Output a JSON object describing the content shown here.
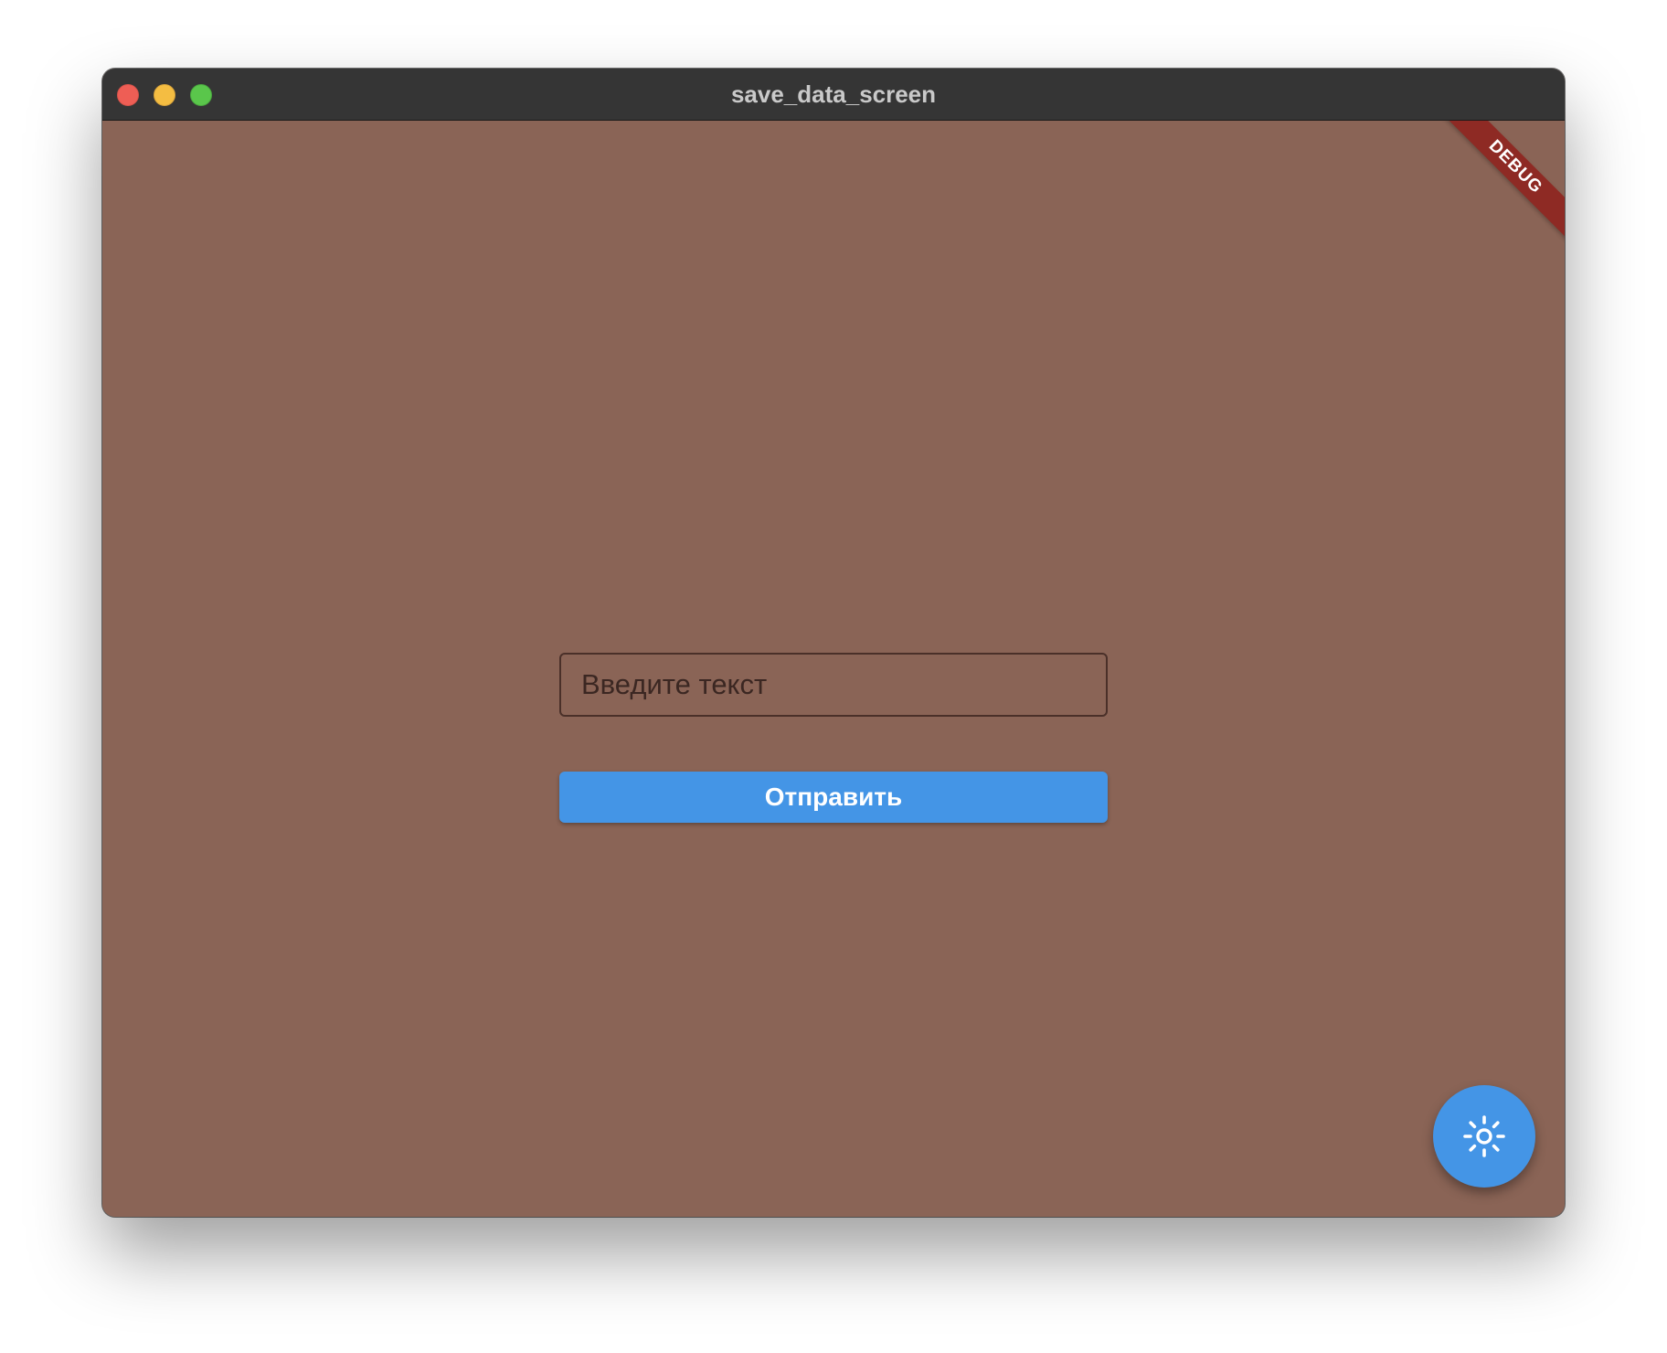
{
  "window": {
    "title": "save_data_screen"
  },
  "colors": {
    "background": "#8a6456",
    "titlebar": "#353535",
    "accent": "#4495e6",
    "debug_banner": "#8e2a24",
    "traffic_close": "#ee5e55",
    "traffic_minimize": "#f4bd42",
    "traffic_maximize": "#5ac64b"
  },
  "debug_banner": {
    "label": "DEBUG"
  },
  "form": {
    "text_input": {
      "value": "",
      "placeholder": "Введите текст"
    },
    "submit_label": "Отправить"
  },
  "fab": {
    "icon": "brightness-icon"
  }
}
